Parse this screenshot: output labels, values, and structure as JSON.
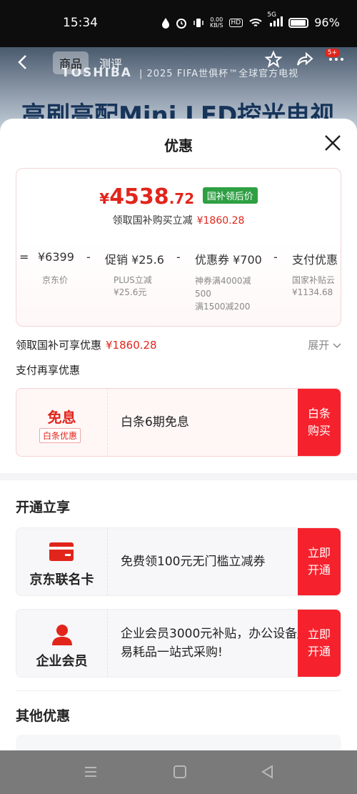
{
  "status_bar": {
    "time": "15:34",
    "net_speed_top": "0.00",
    "net_speed_bottom": "KB/S",
    "hd": "HD",
    "signal": "5G",
    "battery": "96%"
  },
  "product_page": {
    "tabs": [
      {
        "label": "商品",
        "active": true
      },
      {
        "label": "测评",
        "active": false
      }
    ],
    "badge": "5+",
    "brand_logo": "TOSHIBA",
    "brand_text": "| 2025 FIFA世俱杯™全球官方电视",
    "hero_title": "高刷高配Mini LED控光电视"
  },
  "sheet": {
    "title": "优惠",
    "price": {
      "currency": "¥",
      "integer": "4538",
      "decimal": ".72",
      "tag": "国补领后价",
      "sub_label": "领取国补购买立减",
      "sub_amount": "¥1860.28"
    },
    "breakdown": [
      {
        "op": "=",
        "label": "¥6399",
        "note": "京东价"
      },
      {
        "op": "-",
        "label": "促销 ¥25.6",
        "note": "PLUS立减\n¥25.6元"
      },
      {
        "op": "-",
        "label": "优惠券 ¥700",
        "note": "神券满4000减\n500\n满1500减200"
      },
      {
        "op": "-",
        "label": "支付优惠",
        "note": "国家补贴云\n¥1134.68"
      }
    ],
    "gov_subsidy_label": "领取国补可享优惠",
    "gov_subsidy_amount": "¥1860.28",
    "expand_label": "展开",
    "pay_more_label": "支付再享优惠",
    "baitiao": {
      "big": "免息",
      "sub": "白条优惠",
      "text": "白条6期免息",
      "button": "白条\n购买"
    },
    "open_section_title": "开通立享",
    "jd_card": {
      "label": "京东联名卡",
      "text": "免费领100元无门槛立减券",
      "button": "立即\n开通"
    },
    "enterprise": {
      "label": "企业会员",
      "text": "企业会员3000元补贴，办公设备/易耗品一站式采购!",
      "button": "立即\n开通"
    },
    "other_section_title": "其他优惠"
  },
  "colors": {
    "accent_red": "#e1251b",
    "button_red": "#f5222d",
    "tag_green": "#2ea043"
  }
}
